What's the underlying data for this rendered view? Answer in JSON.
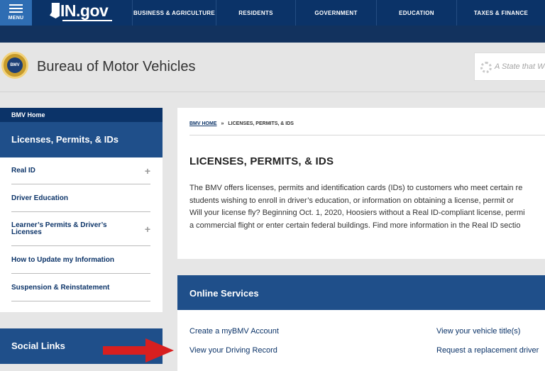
{
  "nav": {
    "menu_label": "MENU",
    "logo_text": "IN.gov",
    "items": [
      {
        "label": "BUSINESS & AGRICULTURE"
      },
      {
        "label": "RESIDENTS"
      },
      {
        "label": "GOVERNMENT"
      },
      {
        "label": "EDUCATION"
      },
      {
        "label": "TAXES & FINANCE"
      }
    ]
  },
  "agency": {
    "seal_text": "BMV",
    "title": "Bureau of Motor Vehicles",
    "tagline": "A State that Wor"
  },
  "sidebar": {
    "home_label": "BMV Home",
    "section_title": "Licenses, Permits, & IDs",
    "items": [
      {
        "label": "Real ID",
        "expandable": true
      },
      {
        "label": "Driver Education",
        "expandable": false
      },
      {
        "label": "Learner’s Permits & Driver’s Licenses",
        "expandable": true
      },
      {
        "label": "How to Update my Information",
        "expandable": false
      },
      {
        "label": "Suspension & Reinstatement",
        "expandable": false
      }
    ],
    "expand_glyph": "+",
    "social_title": "Social Links"
  },
  "main": {
    "breadcrumb": {
      "home": "BMV HOME",
      "separator": "»",
      "current": "LICENSES, PERMITS, & IDS"
    },
    "title": "LICENSES, PERMITS, & IDS",
    "paragraphs": [
      "The BMV offers licenses, permits and identification cards (IDs) to customers who meet certain re",
      "students wishing to enroll in driver’s education, or information on obtaining a license, permit or",
      "Will your license fly? Beginning Oct. 1, 2020, Hoosiers without a Real ID-compliant license, permi",
      "a commercial flight or enter certain federal buildings. Find more information in the Real ID sectio"
    ]
  },
  "services": {
    "title": "Online Services",
    "links": [
      {
        "label": "Create a myBMV Account"
      },
      {
        "label": "View your vehicle title(s)"
      },
      {
        "label": "View your Driving Record"
      },
      {
        "label": "Request a replacement driver"
      }
    ]
  },
  "colors": {
    "nav_bg": "#0b3368",
    "menu_bg": "#2e6db3",
    "section_blue": "#1f4f8a",
    "link": "#0b3368",
    "arrow": "#d81f1f"
  },
  "icons": [
    "hamburger-icon",
    "indiana-state-icon",
    "bmv-seal-icon",
    "sun-icon",
    "plus-icon",
    "red-arrow-icon"
  ]
}
